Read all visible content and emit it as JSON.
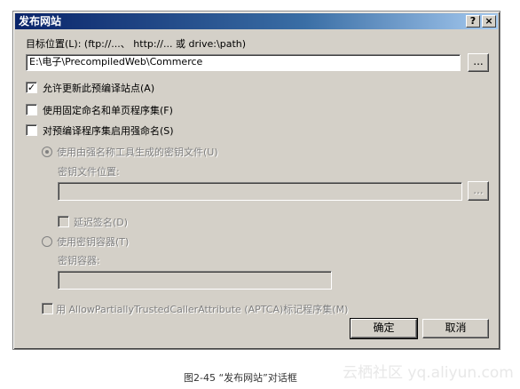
{
  "dialog": {
    "title": "发布网站",
    "help_button": "?",
    "close_button": "×"
  },
  "target": {
    "label": "目标位置(L): (ftp://...、 http://... 或 drive:\\path)",
    "value": "E:\\电子\\PrecompiledWeb\\Commerce",
    "browse_label": "..."
  },
  "options": {
    "allow_update": {
      "label": "允许更新此预编译站点(A)",
      "checked": true
    },
    "fixed_naming": {
      "label": "使用固定命名和单页程序集(F)",
      "checked": false
    },
    "strong_name": {
      "label": "对预编译程序集启用强命名(S)",
      "checked": false
    }
  },
  "strong_name_section": {
    "key_file_radio_label": "使用由强名称工具生成的密钥文件(U)",
    "key_file_location_label": "密钥文件位置:",
    "key_file_location_value": "",
    "key_file_browse_label": "...",
    "delay_sign_label": "延迟签名(D)",
    "key_container_radio_label": "使用密钥容器(T)",
    "key_container_label": "密钥容器:",
    "key_container_value": "",
    "aptca_label": "用 AllowPartiallyTrustedCallerAttribute (APTCA)标记程序集(M)"
  },
  "buttons": {
    "ok": "确定",
    "cancel": "取消"
  },
  "figure_caption": "图2-45    “发布网站”对话框",
  "watermark": "云栖社区 yq.aliyun.com"
}
